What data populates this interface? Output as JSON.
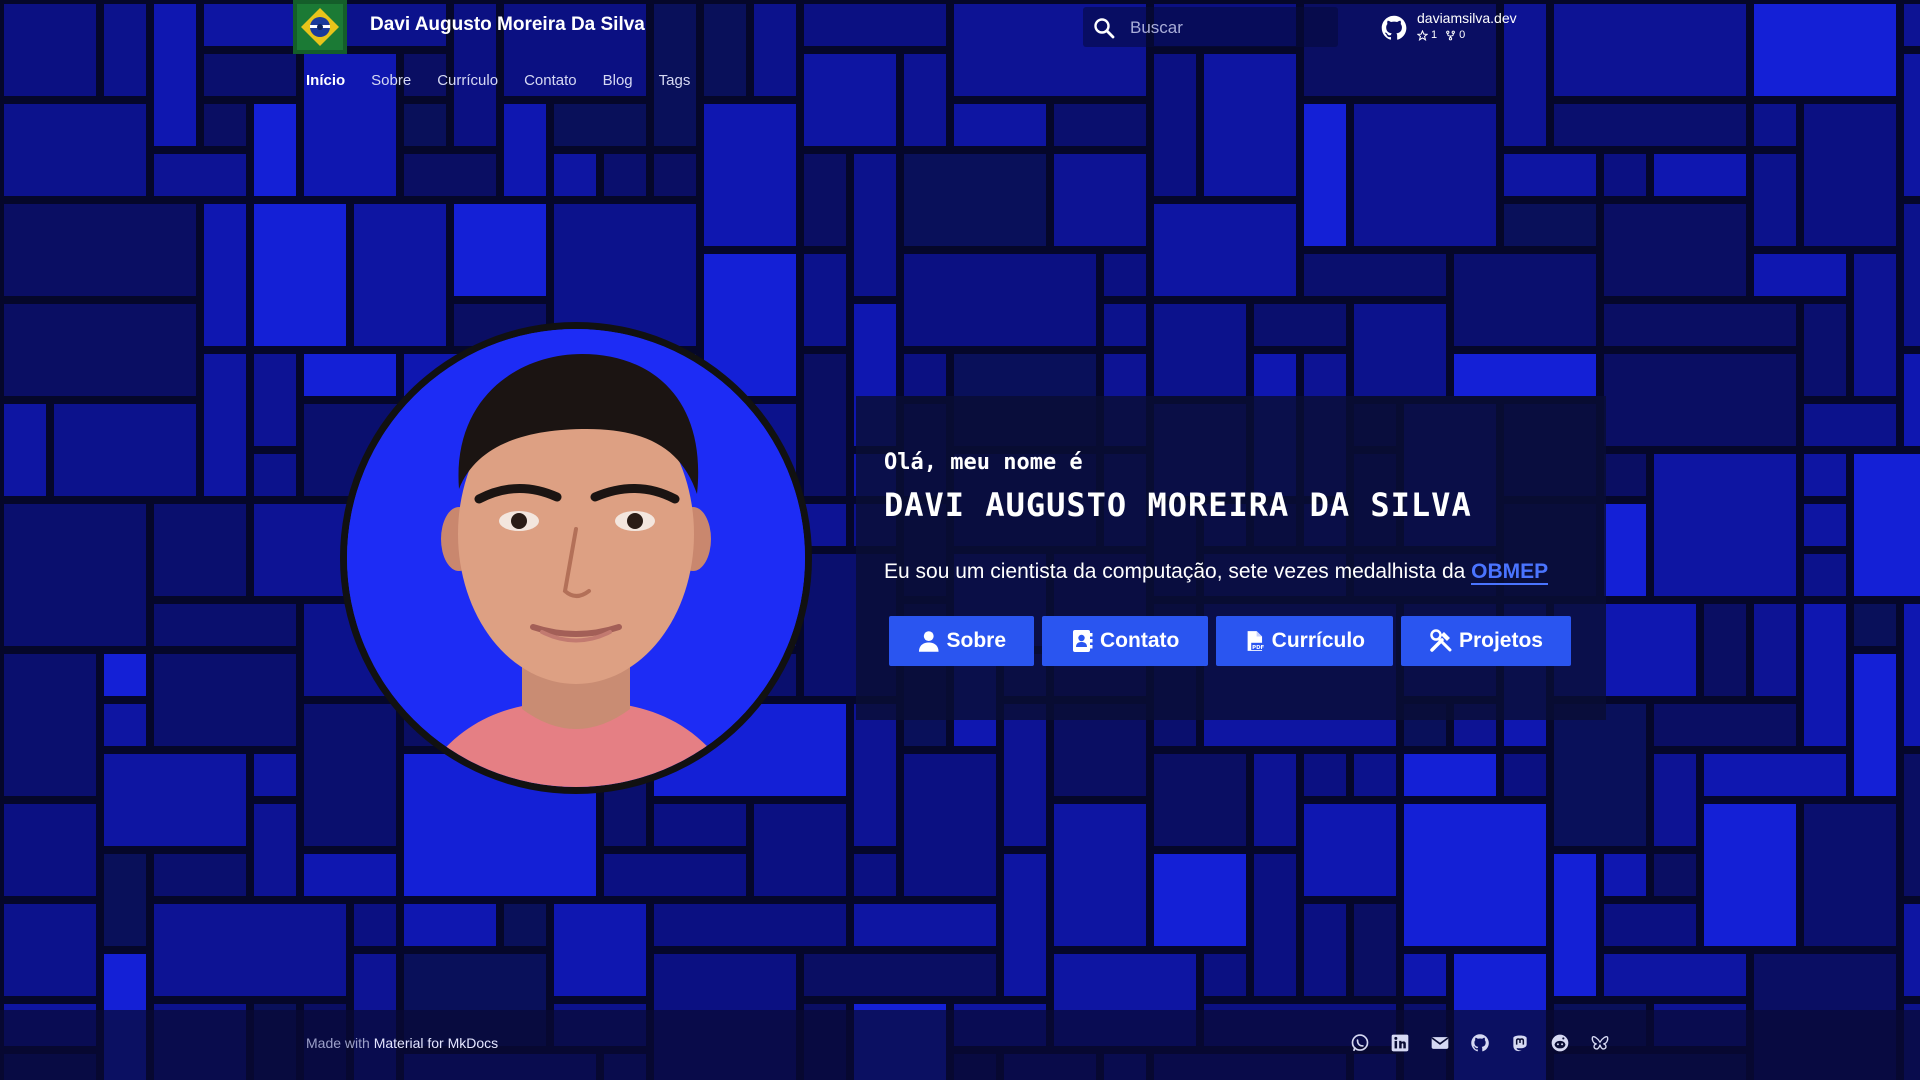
{
  "header": {
    "site_title": "Davi Augusto Moreira Da Silva",
    "search_placeholder": "Buscar",
    "repo": {
      "name": "daviamsilva.dev",
      "stars": "1",
      "forks": "0"
    }
  },
  "tabs": [
    {
      "label": "Início",
      "active": true
    },
    {
      "label": "Sobre",
      "active": false
    },
    {
      "label": "Currículo",
      "active": false
    },
    {
      "label": "Contato",
      "active": false
    },
    {
      "label": "Blog",
      "active": false
    },
    {
      "label": "Tags",
      "active": false
    }
  ],
  "hero": {
    "greeting": "Olá, meu nome é",
    "name": "DAVI AUGUSTO MOREIRA DA SILVA",
    "tagline": "Eu sou um cientista da computação, sete vezes medalhista da",
    "tagline_link": "OBMEP",
    "buttons": {
      "sobre": "Sobre",
      "contato": "Contato",
      "curriculo": "Currículo",
      "projetos": "Projetos"
    }
  },
  "footer": {
    "made_with_prefix": "Made with",
    "made_with_link": "Material for MkDocs",
    "social_icons": [
      "whatsapp-icon",
      "linkedin-icon",
      "mail-icon",
      "github-icon",
      "mastodon-icon",
      "reddit-icon",
      "bluesky-icon"
    ]
  },
  "colors": {
    "accent": "#2a55f0",
    "link": "#4a74ff",
    "background": "#060a3a",
    "avatar_background": "#1d2cf5"
  }
}
